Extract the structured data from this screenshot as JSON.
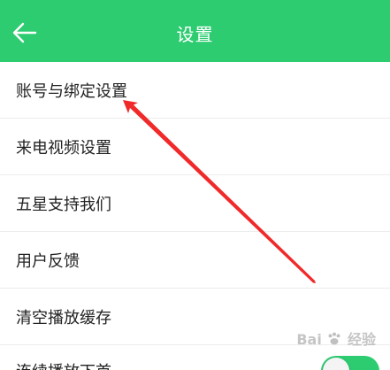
{
  "header": {
    "title": "设置",
    "background_color": "#2ecc71",
    "back_icon": "arrow-left-icon"
  },
  "settings": {
    "items": [
      {
        "label": "账号与绑定设置"
      },
      {
        "label": "来电视频设置"
      },
      {
        "label": "五星支持我们"
      },
      {
        "label": "用户反馈"
      },
      {
        "label": "清空播放缓存"
      },
      {
        "label": "连续播放下首",
        "has_toggle": true,
        "toggle_on": true
      }
    ]
  },
  "annotation": {
    "arrow_color": "#f02a2a"
  },
  "watermark": {
    "text_left": "Bai",
    "text_right": "经验",
    "icon": "baidu-paw-icon"
  }
}
